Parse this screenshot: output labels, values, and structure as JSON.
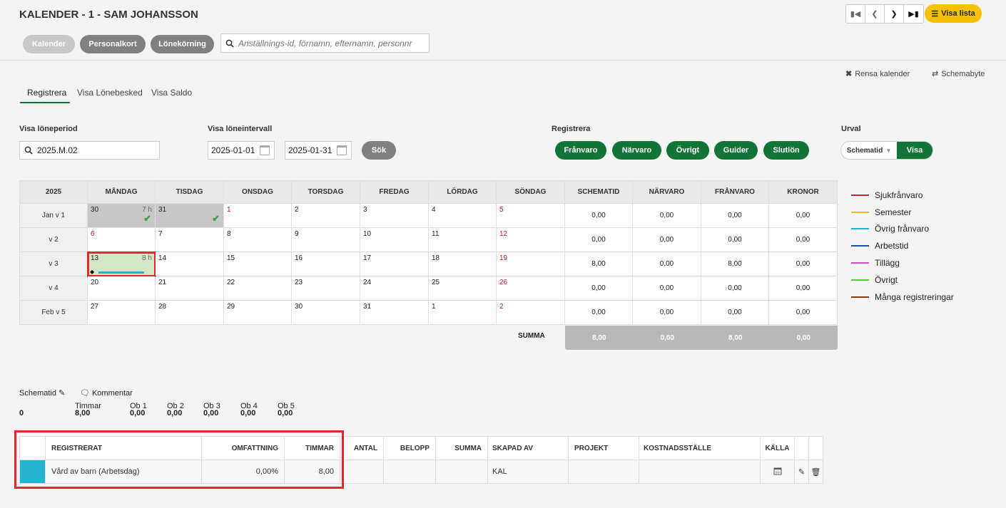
{
  "header": {
    "title": "KALENDER - 1 - SAM JOHANSSON",
    "visa_lista": "Visa lista",
    "btn_kalender": "Kalender",
    "btn_personalkort": "Personalkort",
    "btn_lonekorning": "Lönekörning",
    "search_placeholder": "Anställnings-id, förnamn, efternamn, personnr"
  },
  "actions": {
    "rensa": "Rensa kalender",
    "schemabyte": "Schemabyte"
  },
  "tabs": [
    "Registrera",
    "Visa Lönebesked",
    "Visa Saldo"
  ],
  "filters": {
    "period_label": "Visa löneperiod",
    "period_value": "2025.M.02",
    "interval_label": "Visa löneintervall",
    "date_from": "2025-01-01",
    "date_to": "2025-01-31",
    "sok": "Sök",
    "registrera_label": "Registrera",
    "reg_buttons": [
      "Frånvaro",
      "Närvaro",
      "Övrigt",
      "Guider",
      "Slutlön"
    ],
    "urval_label": "Urval",
    "urval_option": "Schematid",
    "urval_visa": "Visa"
  },
  "calendar": {
    "headers": [
      "2025",
      "MÅNDAG",
      "TISDAG",
      "ONSDAG",
      "TORSDAG",
      "FREDAG",
      "LÖRDAG",
      "SÖNDAG",
      "SCHEMATID",
      "NÄRVARO",
      "FRÅNVARO",
      "KRONOR"
    ],
    "rows": [
      {
        "week": "Jan v 1",
        "days": [
          "30",
          "31",
          "1",
          "2",
          "3",
          "4",
          "5"
        ],
        "totals": [
          "0,00",
          "0,00",
          "0,00",
          "0,00"
        ]
      },
      {
        "week": "v 2",
        "days": [
          "6",
          "7",
          "8",
          "9",
          "10",
          "11",
          "12"
        ],
        "totals": [
          "0,00",
          "0,00",
          "0,00",
          "0,00"
        ]
      },
      {
        "week": "v 3",
        "days": [
          "13",
          "14",
          "15",
          "16",
          "17",
          "18",
          "19"
        ],
        "totals": [
          "8,00",
          "0,00",
          "8,00",
          "0,00"
        ]
      },
      {
        "week": "v 4",
        "days": [
          "20",
          "21",
          "22",
          "23",
          "24",
          "25",
          "26"
        ],
        "totals": [
          "0,00",
          "0,00",
          "0,00",
          "0,00"
        ]
      },
      {
        "week": "Feb v 5",
        "days": [
          "27",
          "28",
          "29",
          "30",
          "31",
          "1",
          "2"
        ],
        "totals": [
          "0,00",
          "0,00",
          "0,00",
          "0,00"
        ]
      }
    ],
    "hours": {
      "r0d0": "7 h",
      "r2d0": "8 h"
    },
    "summa_label": "SUMMA",
    "summa": [
      "8,00",
      "0,00",
      "8,00",
      "0,00"
    ]
  },
  "legend": [
    {
      "label": "Sjukfrånvaro",
      "color": "#d0262f"
    },
    {
      "label": "Semester",
      "color": "#f2b632"
    },
    {
      "label": "Övrig frånvaro",
      "color": "#24b4d0"
    },
    {
      "label": "Arbetstid",
      "color": "#1f4fa8"
    },
    {
      "label": "Tillägg",
      "color": "#d64fc0"
    },
    {
      "label": "Övrigt",
      "color": "#5cc937"
    },
    {
      "label": "Många registreringar",
      "color": "#8a3a12"
    }
  ],
  "summary": {
    "schematid": "Schematid",
    "kommentar": "Kommentar",
    "value0": "0",
    "cols": [
      {
        "label": "Timmar",
        "value": "8,00"
      },
      {
        "label": "Ob 1",
        "value": "0,00"
      },
      {
        "label": "Ob 2",
        "value": "0,00"
      },
      {
        "label": "Ob 3",
        "value": "0,00"
      },
      {
        "label": "Ob 4",
        "value": "0,00"
      },
      {
        "label": "Ob 5",
        "value": "0,00"
      }
    ]
  },
  "registrations": {
    "headers": [
      "REGISTRERAT",
      "OMFATTNING",
      "TIMMAR",
      "ANTAL",
      "BELOPP",
      "SUMMA",
      "SKAPAD AV",
      "PROJEKT",
      "KOSTNADSSTÄLLE",
      "KÄLLA"
    ],
    "row": {
      "color": "#24b4d0",
      "registrerat": "Vård av barn (Arbetsdag)",
      "omfattning": "0,00%",
      "timmar": "8,00",
      "skapad_av": "KAL"
    }
  }
}
